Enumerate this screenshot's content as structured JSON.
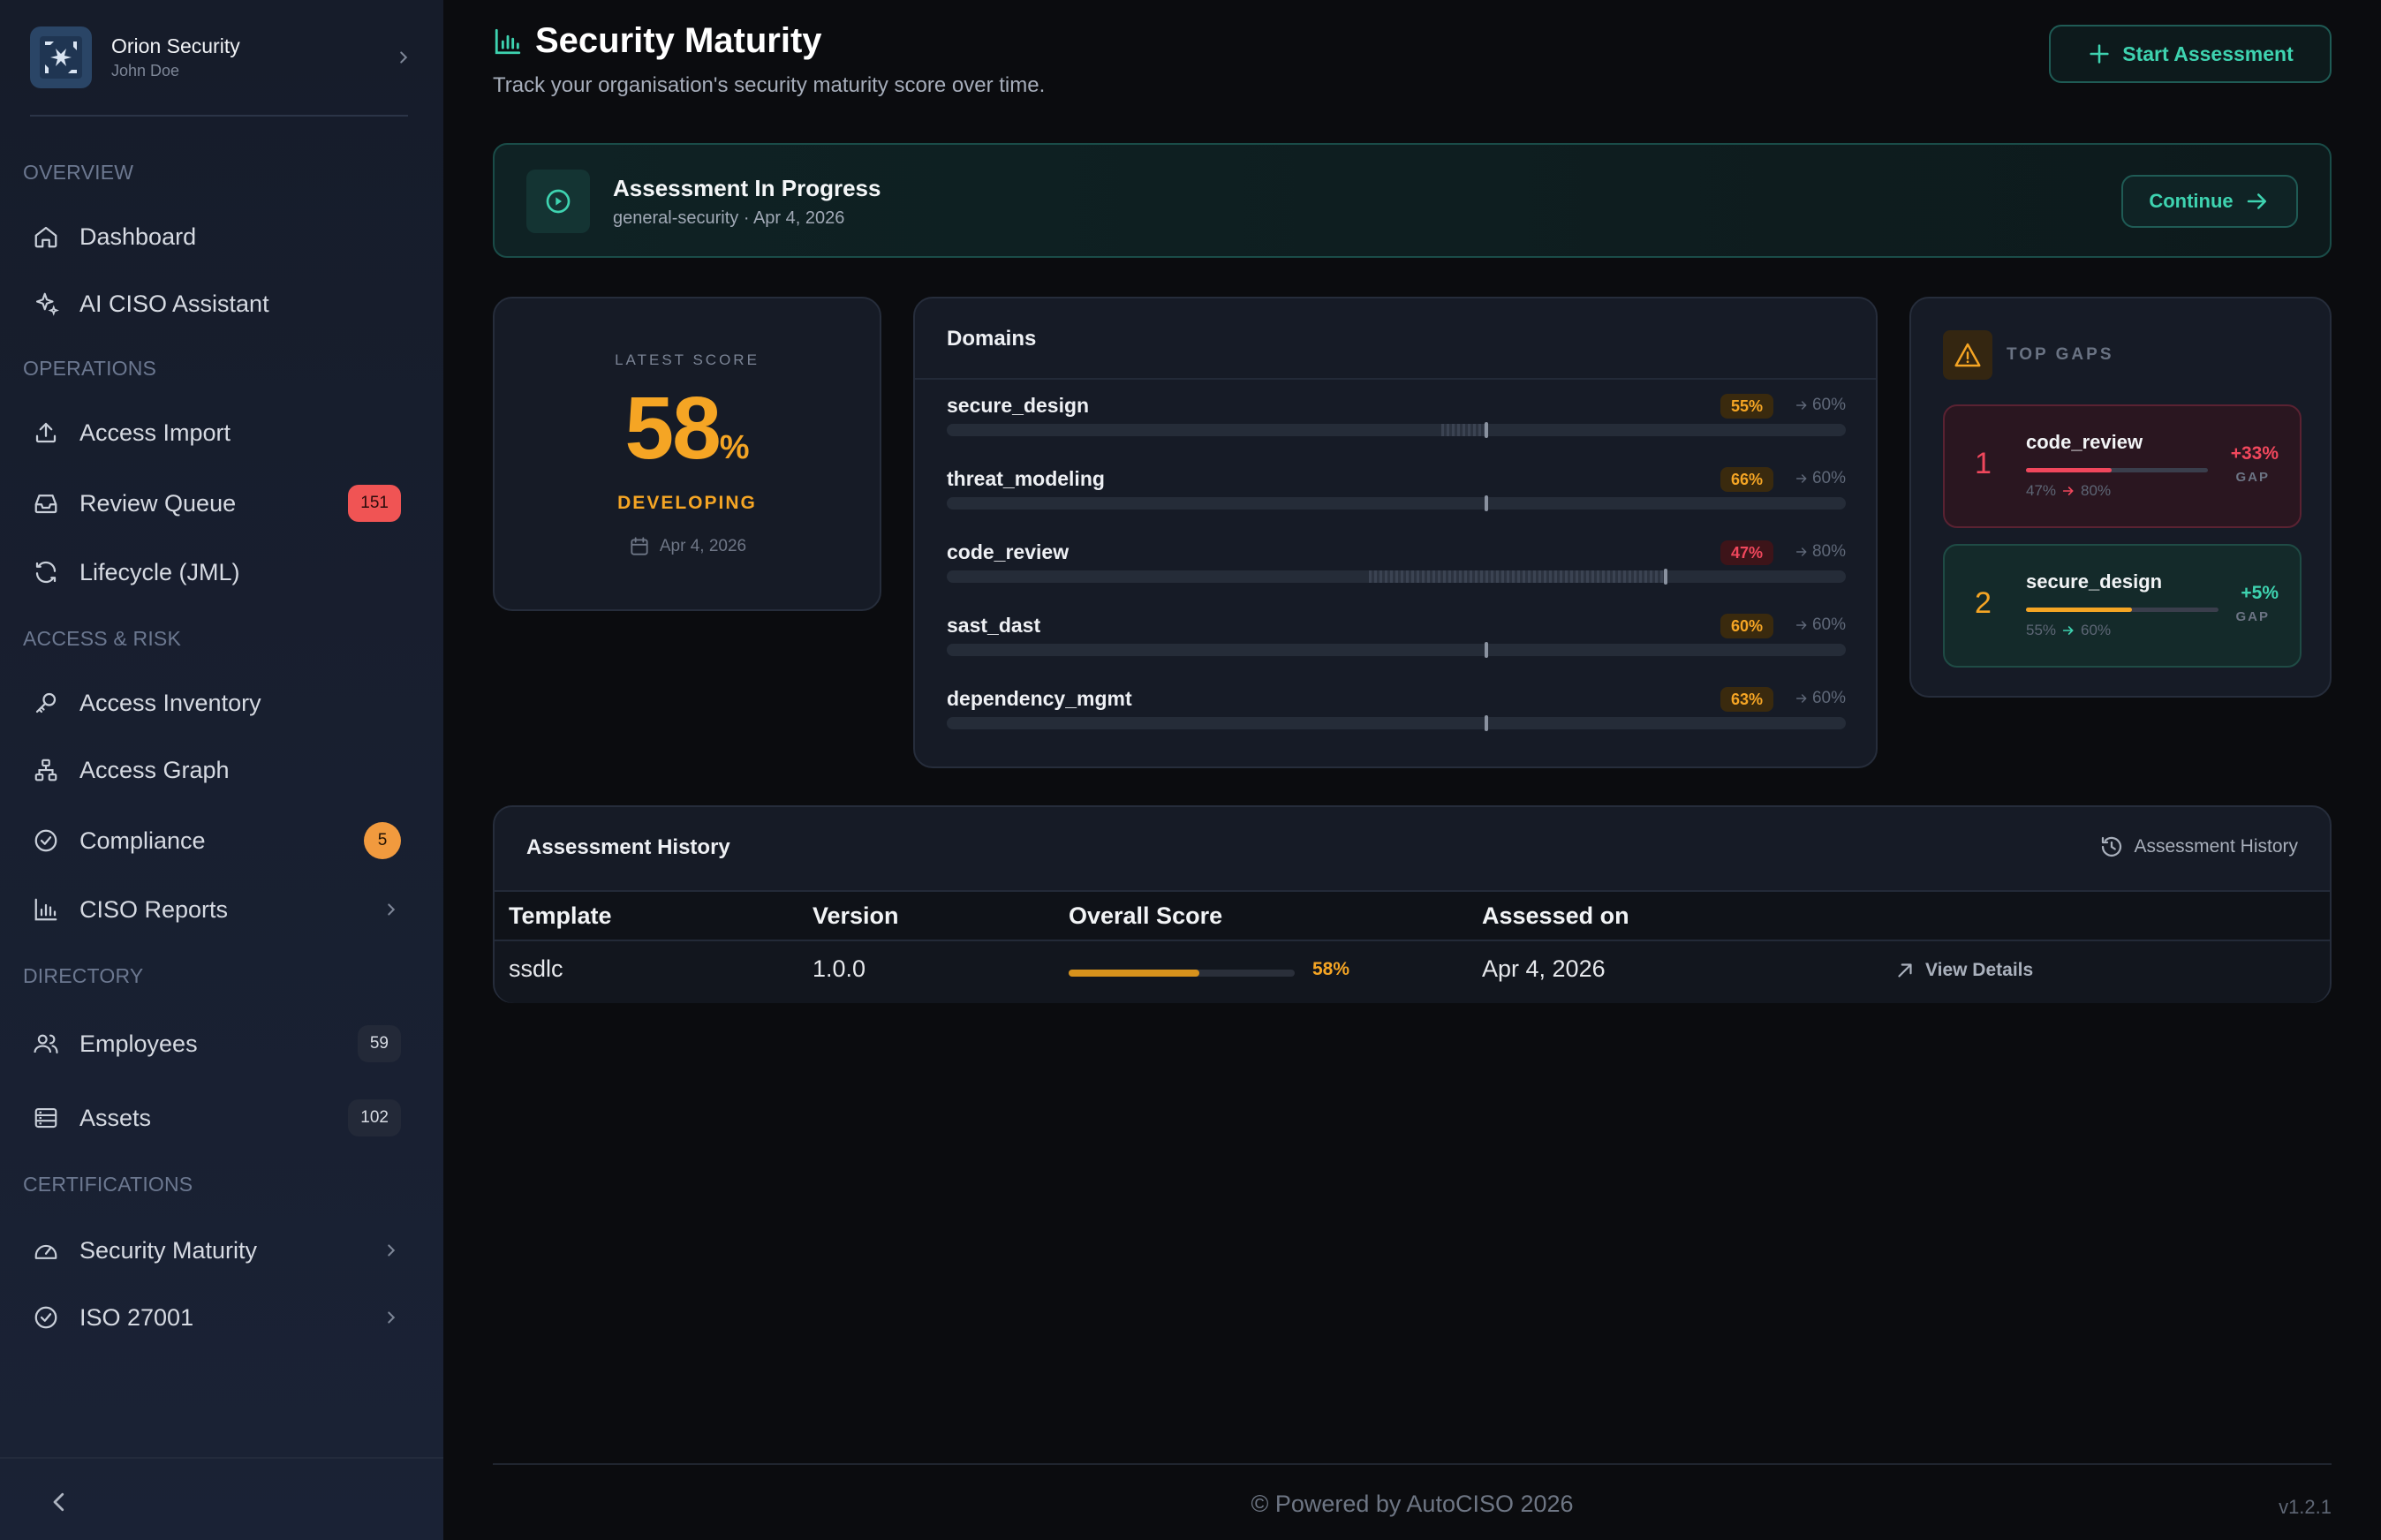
{
  "org": {
    "name": "Orion Security",
    "user": "John Doe"
  },
  "sidebar": {
    "sections": [
      {
        "label": "OVERVIEW"
      },
      {
        "label": "OPERATIONS"
      },
      {
        "label": "ACCESS & RISK"
      },
      {
        "label": "DIRECTORY"
      },
      {
        "label": "CERTIFICATIONS"
      }
    ],
    "items": [
      {
        "label": "Dashboard",
        "icon": "home-icon"
      },
      {
        "label": "AI CISO Assistant",
        "icon": "sparkle-icon"
      },
      {
        "label": "Access Import",
        "icon": "upload-icon"
      },
      {
        "label": "Review Queue",
        "icon": "inbox-icon",
        "badge": "151"
      },
      {
        "label": "Lifecycle (JML)",
        "icon": "refresh-icon"
      },
      {
        "label": "Access Inventory",
        "icon": "key-icon"
      },
      {
        "label": "Access Graph",
        "icon": "graph-icon"
      },
      {
        "label": "Compliance",
        "icon": "check-circle-icon",
        "badge": "5"
      },
      {
        "label": "CISO Reports",
        "icon": "bar-chart-icon"
      },
      {
        "label": "Employees",
        "icon": "users-icon",
        "badge": "59"
      },
      {
        "label": "Assets",
        "icon": "server-icon",
        "badge": "102"
      },
      {
        "label": "Security Maturity",
        "icon": "gauge-icon"
      },
      {
        "label": "ISO 27001",
        "icon": "badge-check-icon"
      }
    ]
  },
  "header": {
    "title": "Security Maturity",
    "subtitle": "Track your organisation's security maturity score over time.",
    "start_button": "Start Assessment"
  },
  "banner": {
    "title": "Assessment In Progress",
    "subtitle": "general-security · Apr 4, 2026",
    "continue_label": "Continue"
  },
  "score": {
    "label": "LATEST SCORE",
    "value": "58",
    "unit": "%",
    "level": "DEVELOPING",
    "date": "Apr 4, 2026"
  },
  "domains": {
    "title": "Domains",
    "rows": [
      {
        "name": "secure_design",
        "score": "55%",
        "target": "60%",
        "score_value": 55,
        "target_value": 60,
        "status": "orange"
      },
      {
        "name": "threat_modeling",
        "score": "66%",
        "target": "60%",
        "score_value": 66,
        "target_value": 60,
        "status": "orange"
      },
      {
        "name": "code_review",
        "score": "47%",
        "target": "80%",
        "score_value": 47,
        "target_value": 80,
        "status": "red"
      },
      {
        "name": "sast_dast",
        "score": "60%",
        "target": "60%",
        "score_value": 60,
        "target_value": 60,
        "status": "orange"
      },
      {
        "name": "dependency_mgmt",
        "score": "63%",
        "target": "60%",
        "score_value": 63,
        "target_value": 60,
        "status": "orange"
      }
    ]
  },
  "top_gaps": {
    "title": "TOP GAPS",
    "items": [
      {
        "rank": "1",
        "name": "code_review",
        "from": "47%",
        "to": "80%",
        "delta": "+33%",
        "delta_label": "GAP",
        "fill_fraction": 0.47
      },
      {
        "rank": "2",
        "name": "secure_design",
        "from": "55%",
        "to": "60%",
        "delta": "+5%",
        "delta_label": "GAP",
        "fill_fraction": 0.55
      }
    ]
  },
  "history": {
    "title": "Assessment History",
    "link_label": "Assessment History",
    "columns": [
      "Template",
      "Version",
      "Overall Score",
      "Assessed on"
    ],
    "rows": [
      {
        "template": "ssdlc",
        "version": "1.0.0",
        "score": "58%",
        "score_fraction": 0.58,
        "date": "Apr 4, 2026",
        "action": "View Details"
      }
    ]
  },
  "footer": {
    "text": "© Powered by AutoCISO 2026",
    "version": "v1.2.1"
  },
  "colors": {
    "accent": "#3ed3b0",
    "warning": "#f5a524",
    "danger": "#f0475c",
    "sidebar_bg": "#161c2a"
  }
}
